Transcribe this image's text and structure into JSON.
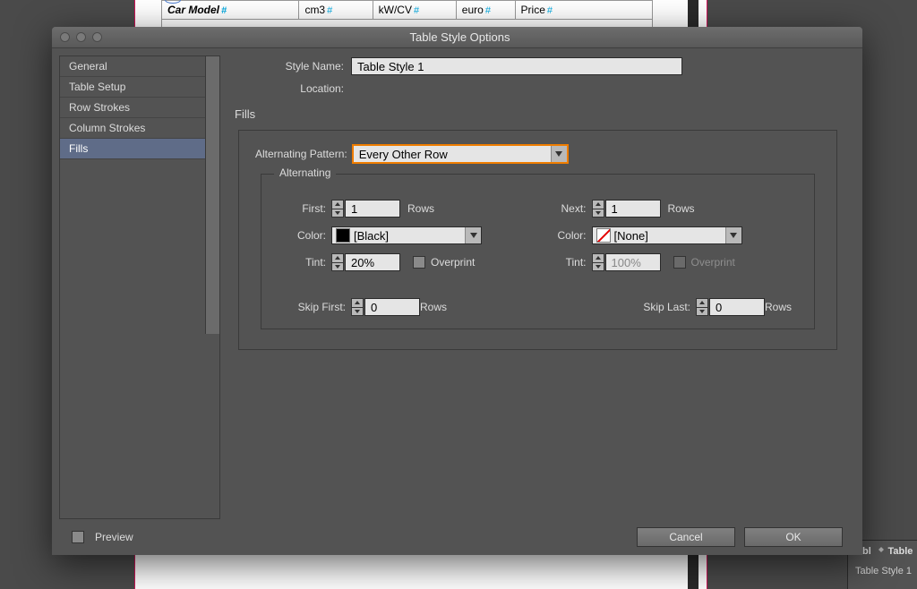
{
  "background": {
    "table_headers": [
      "Car Model",
      "cm3",
      "kW/CV",
      "euro",
      "Price"
    ],
    "panel_tab1": "Tabl",
    "panel_tab2": "Table",
    "panel_item": "Table Style 1"
  },
  "dialog": {
    "title": "Table Style Options",
    "sidebar": {
      "items": [
        "General",
        "Table Setup",
        "Row Strokes",
        "Column Strokes",
        "Fills"
      ],
      "selected_index": 4
    },
    "style_name_label": "Style Name:",
    "style_name_value": "Table Style 1",
    "location_label": "Location:",
    "section_title": "Fills",
    "alt_pattern_label": "Alternating Pattern:",
    "alt_pattern_value": "Every Other Row",
    "inner_group_title": "Alternating",
    "left": {
      "first_label": "First:",
      "first_value": "1",
      "rows_suffix": "Rows",
      "color_label": "Color:",
      "color_value": "[Black]",
      "tint_label": "Tint:",
      "tint_value": "20%",
      "overprint_label": "Overprint"
    },
    "right": {
      "next_label": "Next:",
      "next_value": "1",
      "rows_suffix": "Rows",
      "color_label": "Color:",
      "color_value": "[None]",
      "tint_label": "Tint:",
      "tint_value": "100%",
      "overprint_label": "Overprint"
    },
    "skip_first_label": "Skip First:",
    "skip_first_value": "0",
    "skip_last_label": "Skip Last:",
    "skip_last_value": "0",
    "skip_suffix": "Rows",
    "preview_label": "Preview",
    "cancel_label": "Cancel",
    "ok_label": "OK"
  }
}
